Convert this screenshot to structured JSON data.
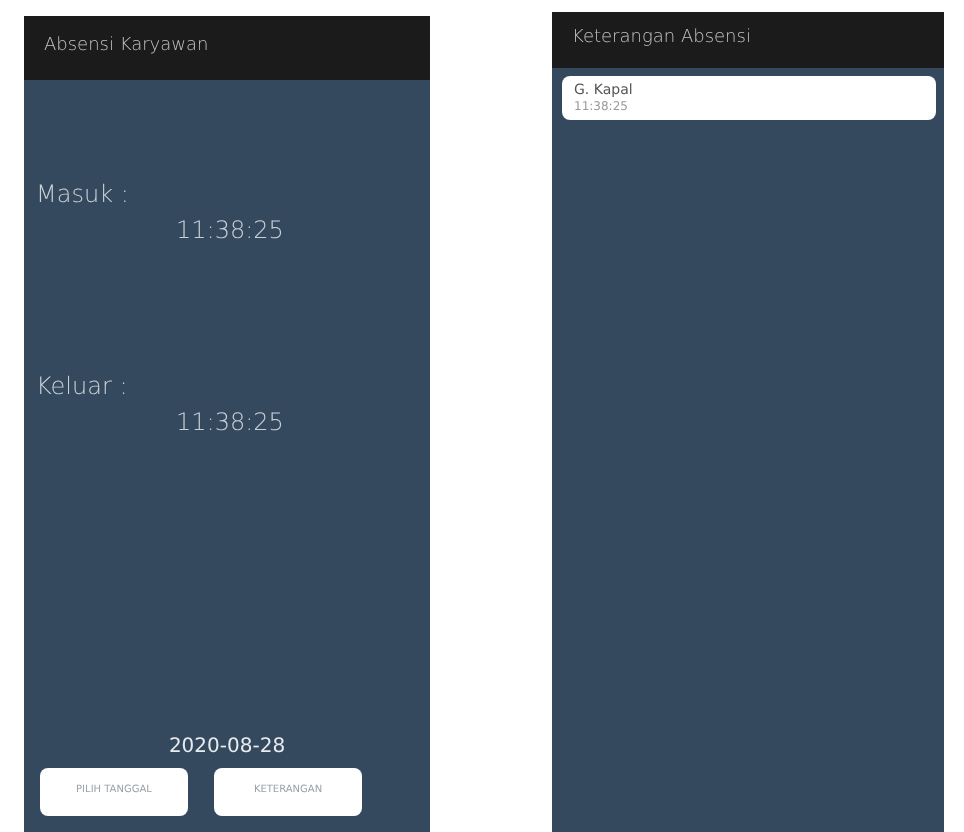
{
  "screens": [
    {
      "kind": "attendance",
      "title": "Absensi Karyawan",
      "entries": [
        {
          "label": "Masuk :",
          "time": "11:38:25"
        },
        {
          "label": "Keluar :",
          "time": "11:38:25"
        }
      ],
      "date": "2020-08-28",
      "buttons": [
        "PILIH TANGGAL",
        "KETERANGAN"
      ]
    },
    {
      "kind": "list",
      "title": "Keterangan Absensi",
      "items": [
        {
          "name": "G. Kapal",
          "time": "11:38:25"
        }
      ]
    }
  ]
}
